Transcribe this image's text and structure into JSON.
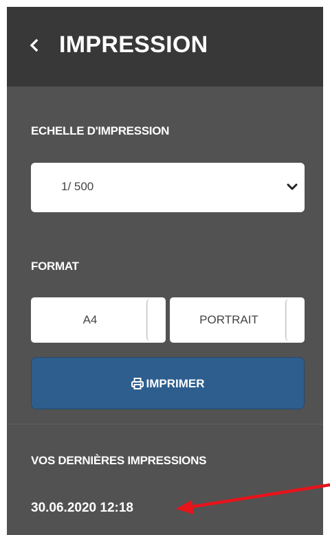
{
  "header": {
    "back_icon": "chevron-left-icon",
    "title": "IMPRESSION"
  },
  "scale": {
    "label": "ECHELLE D'IMPRESSION",
    "selected": "1/ 500",
    "dropdown_icon": "chevron-down-icon"
  },
  "format": {
    "label": "FORMAT",
    "paper": "A4",
    "orientation": "PORTRAIT"
  },
  "print_button": {
    "icon": "printer-icon",
    "label": "IMPRIMER"
  },
  "history": {
    "label": "VOS DERNIÈRES IMPRESSIONS",
    "items": [
      {
        "datetime": "30.06.2020 12:18"
      }
    ]
  },
  "annotation": {
    "icon": "red-arrow-icon",
    "color": "#e8141b"
  },
  "colors": {
    "header_bg": "#383838",
    "panel_bg": "#525252",
    "button_bg": "#2e5e8e"
  }
}
